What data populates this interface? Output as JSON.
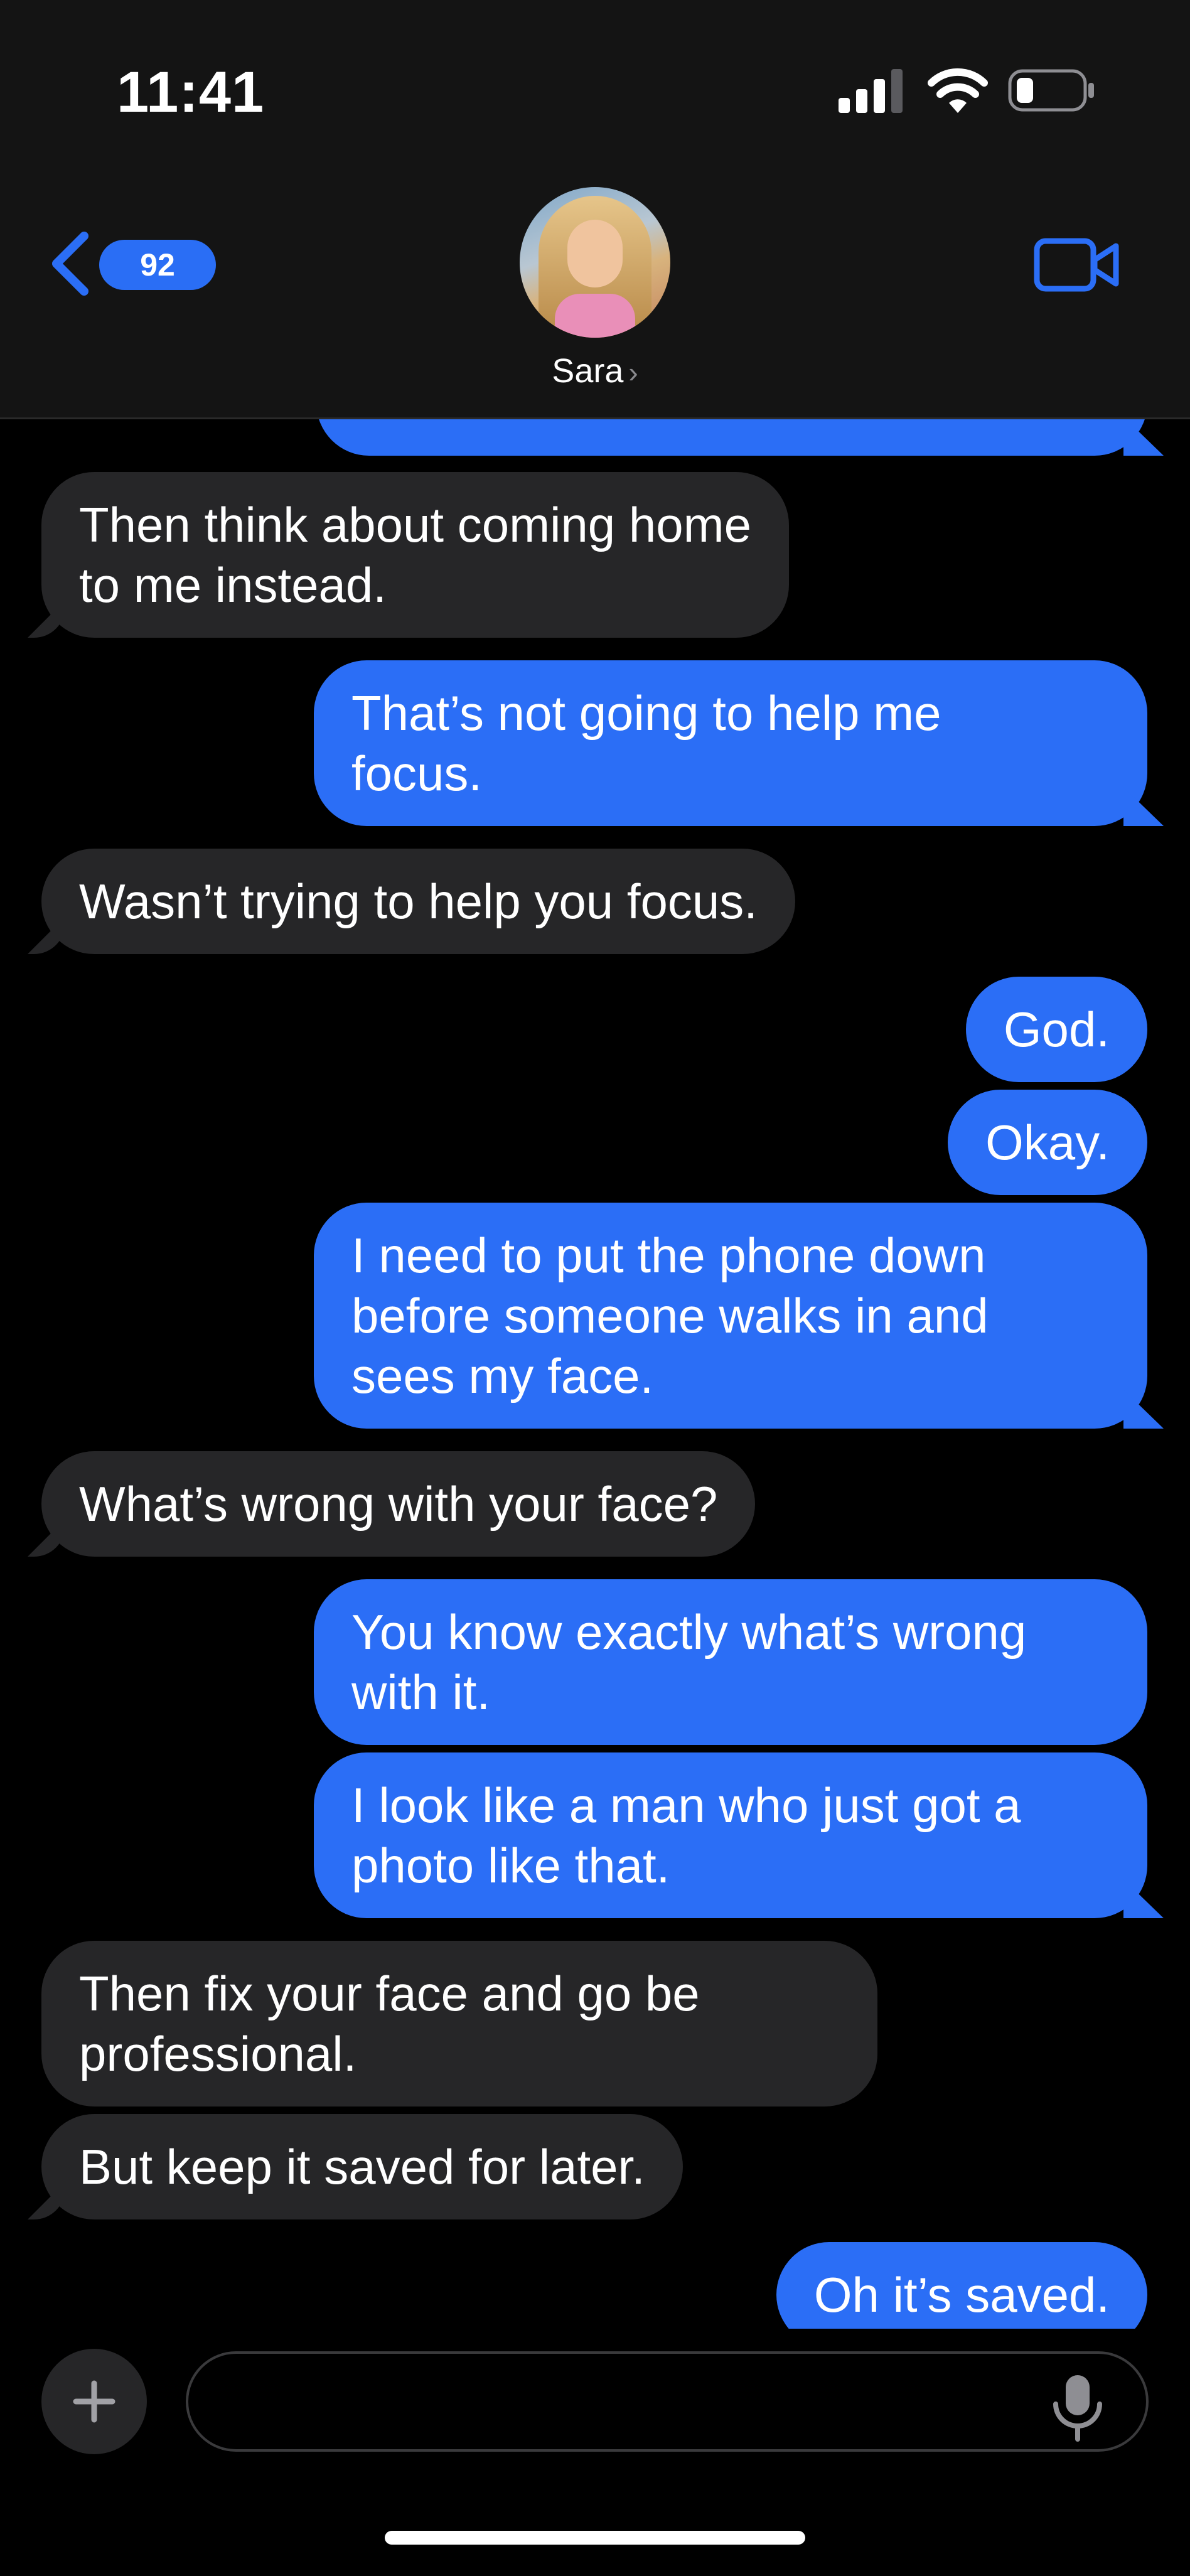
{
  "status_bar": {
    "time": "11:41",
    "icons": [
      "cellular-signal-icon",
      "wifi-icon",
      "battery-icon"
    ]
  },
  "header": {
    "back_badge": "92",
    "contact_name": "Sara",
    "contact_chevron": "›",
    "icons": [
      "back-chevron-icon",
      "avatar",
      "video-camera-icon"
    ],
    "accent_color": "#2b6ef6"
  },
  "conversation": {
    "partial_top_bubble": "",
    "messages": [
      {
        "direction": "in",
        "text_lines": [
          "Then think about coming home",
          "to me instead."
        ]
      },
      {
        "direction": "out",
        "text_lines": [
          "That’s not going to help me",
          "focus."
        ]
      },
      {
        "direction": "in",
        "text_lines": [
          "Wasn’t trying to help you focus."
        ]
      },
      {
        "direction": "out",
        "text_lines": [
          "God."
        ]
      },
      {
        "direction": "out",
        "text_lines": [
          "Okay."
        ]
      },
      {
        "direction": "out",
        "text_lines": [
          "I need to put the phone down",
          "before someone walks in and",
          "sees my face."
        ]
      },
      {
        "direction": "in",
        "text_lines": [
          "What’s wrong with your face?"
        ]
      },
      {
        "direction": "out",
        "text_lines": [
          "You know exactly what’s wrong",
          "with it."
        ]
      },
      {
        "direction": "out",
        "text_lines": [
          "I look like a man who just got a",
          "photo like that."
        ]
      },
      {
        "direction": "in",
        "text_lines": [
          "Then fix your face and go be",
          "professional."
        ]
      },
      {
        "direction": "in",
        "text_lines": [
          "But keep it saved for later."
        ]
      },
      {
        "direction": "out",
        "text_lines": [
          "Oh it’s saved."
        ]
      }
    ],
    "colors": {
      "incoming": "#262628",
      "outgoing": "#2b6ef6"
    }
  },
  "composer": {
    "placeholder": "",
    "icons": [
      "plus-icon",
      "microphone-icon"
    ]
  }
}
